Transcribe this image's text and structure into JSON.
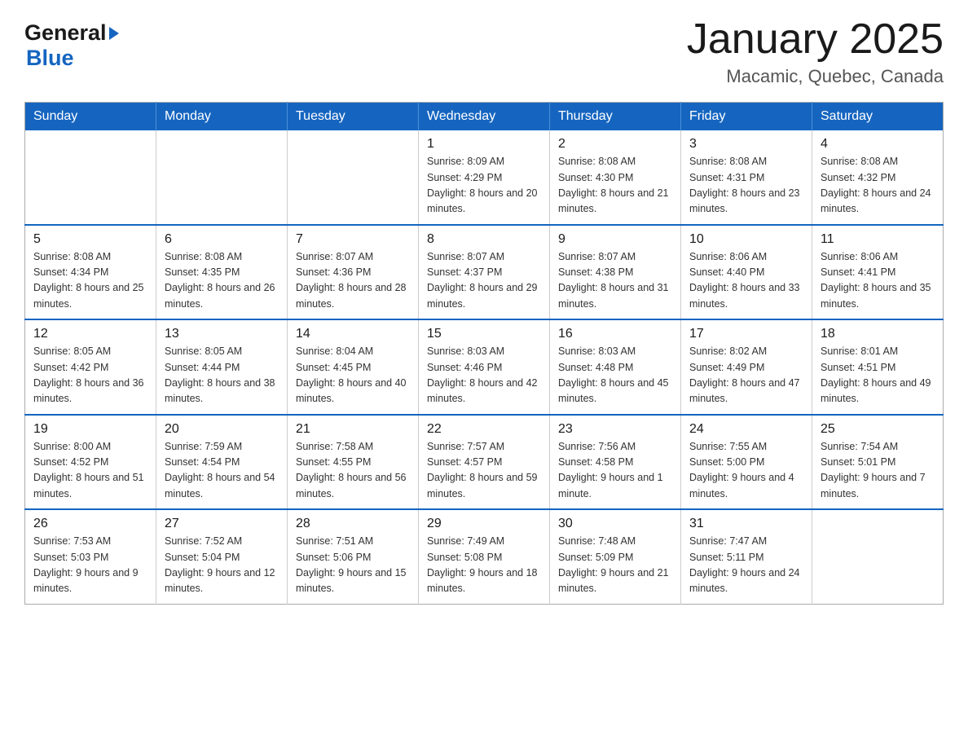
{
  "header": {
    "logo_general": "General",
    "logo_blue": "Blue",
    "title": "January 2025",
    "subtitle": "Macamic, Quebec, Canada"
  },
  "days_of_week": [
    "Sunday",
    "Monday",
    "Tuesday",
    "Wednesday",
    "Thursday",
    "Friday",
    "Saturday"
  ],
  "weeks": [
    [
      {
        "day": "",
        "info": ""
      },
      {
        "day": "",
        "info": ""
      },
      {
        "day": "",
        "info": ""
      },
      {
        "day": "1",
        "info": "Sunrise: 8:09 AM\nSunset: 4:29 PM\nDaylight: 8 hours\nand 20 minutes."
      },
      {
        "day": "2",
        "info": "Sunrise: 8:08 AM\nSunset: 4:30 PM\nDaylight: 8 hours\nand 21 minutes."
      },
      {
        "day": "3",
        "info": "Sunrise: 8:08 AM\nSunset: 4:31 PM\nDaylight: 8 hours\nand 23 minutes."
      },
      {
        "day": "4",
        "info": "Sunrise: 8:08 AM\nSunset: 4:32 PM\nDaylight: 8 hours\nand 24 minutes."
      }
    ],
    [
      {
        "day": "5",
        "info": "Sunrise: 8:08 AM\nSunset: 4:34 PM\nDaylight: 8 hours\nand 25 minutes."
      },
      {
        "day": "6",
        "info": "Sunrise: 8:08 AM\nSunset: 4:35 PM\nDaylight: 8 hours\nand 26 minutes."
      },
      {
        "day": "7",
        "info": "Sunrise: 8:07 AM\nSunset: 4:36 PM\nDaylight: 8 hours\nand 28 minutes."
      },
      {
        "day": "8",
        "info": "Sunrise: 8:07 AM\nSunset: 4:37 PM\nDaylight: 8 hours\nand 29 minutes."
      },
      {
        "day": "9",
        "info": "Sunrise: 8:07 AM\nSunset: 4:38 PM\nDaylight: 8 hours\nand 31 minutes."
      },
      {
        "day": "10",
        "info": "Sunrise: 8:06 AM\nSunset: 4:40 PM\nDaylight: 8 hours\nand 33 minutes."
      },
      {
        "day": "11",
        "info": "Sunrise: 8:06 AM\nSunset: 4:41 PM\nDaylight: 8 hours\nand 35 minutes."
      }
    ],
    [
      {
        "day": "12",
        "info": "Sunrise: 8:05 AM\nSunset: 4:42 PM\nDaylight: 8 hours\nand 36 minutes."
      },
      {
        "day": "13",
        "info": "Sunrise: 8:05 AM\nSunset: 4:44 PM\nDaylight: 8 hours\nand 38 minutes."
      },
      {
        "day": "14",
        "info": "Sunrise: 8:04 AM\nSunset: 4:45 PM\nDaylight: 8 hours\nand 40 minutes."
      },
      {
        "day": "15",
        "info": "Sunrise: 8:03 AM\nSunset: 4:46 PM\nDaylight: 8 hours\nand 42 minutes."
      },
      {
        "day": "16",
        "info": "Sunrise: 8:03 AM\nSunset: 4:48 PM\nDaylight: 8 hours\nand 45 minutes."
      },
      {
        "day": "17",
        "info": "Sunrise: 8:02 AM\nSunset: 4:49 PM\nDaylight: 8 hours\nand 47 minutes."
      },
      {
        "day": "18",
        "info": "Sunrise: 8:01 AM\nSunset: 4:51 PM\nDaylight: 8 hours\nand 49 minutes."
      }
    ],
    [
      {
        "day": "19",
        "info": "Sunrise: 8:00 AM\nSunset: 4:52 PM\nDaylight: 8 hours\nand 51 minutes."
      },
      {
        "day": "20",
        "info": "Sunrise: 7:59 AM\nSunset: 4:54 PM\nDaylight: 8 hours\nand 54 minutes."
      },
      {
        "day": "21",
        "info": "Sunrise: 7:58 AM\nSunset: 4:55 PM\nDaylight: 8 hours\nand 56 minutes."
      },
      {
        "day": "22",
        "info": "Sunrise: 7:57 AM\nSunset: 4:57 PM\nDaylight: 8 hours\nand 59 minutes."
      },
      {
        "day": "23",
        "info": "Sunrise: 7:56 AM\nSunset: 4:58 PM\nDaylight: 9 hours\nand 1 minute."
      },
      {
        "day": "24",
        "info": "Sunrise: 7:55 AM\nSunset: 5:00 PM\nDaylight: 9 hours\nand 4 minutes."
      },
      {
        "day": "25",
        "info": "Sunrise: 7:54 AM\nSunset: 5:01 PM\nDaylight: 9 hours\nand 7 minutes."
      }
    ],
    [
      {
        "day": "26",
        "info": "Sunrise: 7:53 AM\nSunset: 5:03 PM\nDaylight: 9 hours\nand 9 minutes."
      },
      {
        "day": "27",
        "info": "Sunrise: 7:52 AM\nSunset: 5:04 PM\nDaylight: 9 hours\nand 12 minutes."
      },
      {
        "day": "28",
        "info": "Sunrise: 7:51 AM\nSunset: 5:06 PM\nDaylight: 9 hours\nand 15 minutes."
      },
      {
        "day": "29",
        "info": "Sunrise: 7:49 AM\nSunset: 5:08 PM\nDaylight: 9 hours\nand 18 minutes."
      },
      {
        "day": "30",
        "info": "Sunrise: 7:48 AM\nSunset: 5:09 PM\nDaylight: 9 hours\nand 21 minutes."
      },
      {
        "day": "31",
        "info": "Sunrise: 7:47 AM\nSunset: 5:11 PM\nDaylight: 9 hours\nand 24 minutes."
      },
      {
        "day": "",
        "info": ""
      }
    ]
  ]
}
